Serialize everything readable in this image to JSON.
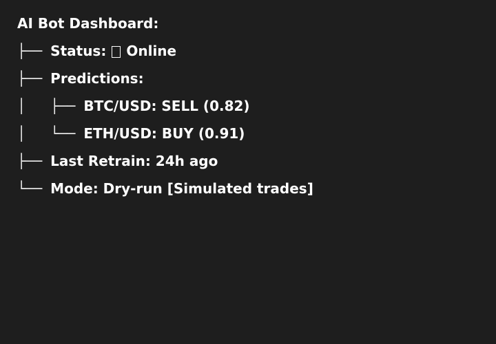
{
  "dashboard": {
    "title": "AI Bot Dashboard:",
    "status": {
      "branch": "├── ",
      "label": "Status:",
      "icon": "status-indicator-icon",
      "value": "Online"
    },
    "predictions": {
      "branch": "├── ",
      "label": "Predictions:",
      "items": [
        {
          "branch": "│   ├── ",
          "text": "BTC/USD: SELL (0.82)"
        },
        {
          "branch": "│   └── ",
          "text": "ETH/USD: BUY (0.91)"
        }
      ]
    },
    "last_retrain": {
      "branch": "├── ",
      "text": "Last Retrain: 24h ago"
    },
    "mode": {
      "branch": "└── ",
      "text": "Mode: Dry-run [Simulated trades]"
    }
  }
}
